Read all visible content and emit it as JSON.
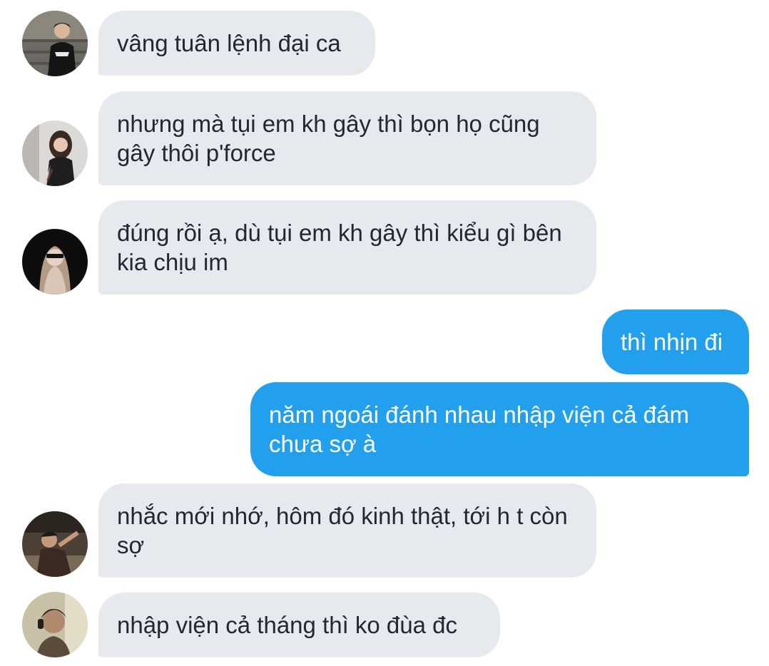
{
  "chat": {
    "messages": [
      {
        "sender": "incoming",
        "avatar_icon": "avatar-boy-stairs-icon",
        "text": "vâng tuân lệnh đại ca"
      },
      {
        "sender": "incoming",
        "avatar_icon": "avatar-girl-mirror-icon",
        "text": "nhưng mà tụi em kh gây thì bọn họ cũng gây thôi p'force"
      },
      {
        "sender": "incoming",
        "avatar_icon": "avatar-girl-sunglasses-icon",
        "text": "đúng rồi ạ, dù tụi em kh gây thì kiểu gì bên kia chịu im"
      },
      {
        "sender": "outgoing",
        "text": "thì nhịn đi"
      },
      {
        "sender": "outgoing",
        "text": "năm ngoái đánh nhau nhập viện cả đám chưa sợ à"
      },
      {
        "sender": "incoming",
        "avatar_icon": "avatar-boy-lying-icon",
        "text": "nhắc mới nhớ, hôm đó kinh thật, tới h t còn sợ"
      },
      {
        "sender": "incoming",
        "avatar_icon": "avatar-boy-headphones-icon",
        "text": "nhập viện cả tháng thì ko đùa đc"
      }
    ]
  }
}
